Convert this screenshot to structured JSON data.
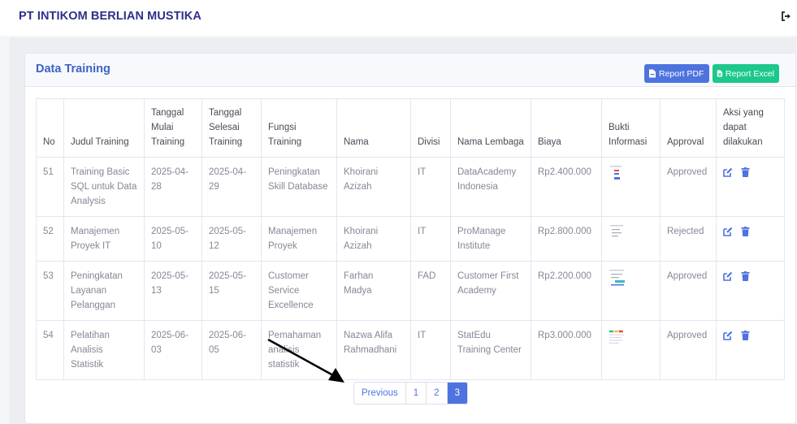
{
  "header": {
    "brand": "PT INTIKOM BERLIAN MUSTIKA"
  },
  "card": {
    "title": "Data Training",
    "report_pdf": "Report PDF",
    "report_excel": "Report Excel"
  },
  "table": {
    "columns": [
      "No",
      "Judul Training",
      "Tanggal Mulai Training",
      "Tanggal Selesai Training",
      "Fungsi Training",
      "Nama",
      "Divisi",
      "Nama Lembaga",
      "Biaya",
      "Bukti Informasi",
      "Approval",
      "Aksi yang dapat dilakukan"
    ],
    "rows": [
      {
        "no": "51",
        "judul": "Training Basic SQL untuk Data Analysis",
        "mulai": "2025-04-28",
        "selesai": "2025-04-29",
        "fungsi": "Peningkatan Skill Database",
        "nama": "Khoirani Azizah",
        "divisi": "IT",
        "lembaga": "DataAcademy Indonesia",
        "biaya": "Rp2.400.000",
        "approval": "Approved"
      },
      {
        "no": "52",
        "judul": "Manajemen Proyek IT",
        "mulai": "2025-05-10",
        "selesai": "2025-05-12",
        "fungsi": "Manajemen Proyek",
        "nama": "Khoirani Azizah",
        "divisi": "IT",
        "lembaga": "ProManage Institute",
        "biaya": "Rp2.800.000",
        "approval": "Rejected"
      },
      {
        "no": "53",
        "judul": "Peningkatan Layanan Pelanggan",
        "mulai": "2025-05-13",
        "selesai": "2025-05-15",
        "fungsi": "Customer Service Excellence",
        "nama": "Farhan Madya",
        "divisi": "FAD",
        "lembaga": "Customer First Academy",
        "biaya": "Rp2.200.000",
        "approval": "Approved"
      },
      {
        "no": "54",
        "judul": "Pelatihan Analisis Statistik",
        "mulai": "2025-06-03",
        "selesai": "2025-06-05",
        "fungsi": "Pemahaman analisis statistik",
        "nama": "Nazwa Alifa Rahmadhani",
        "divisi": "IT",
        "lembaga": "StatEdu Training Center",
        "biaya": "Rp3.000.000",
        "approval": "Approved"
      }
    ]
  },
  "pagination": {
    "previous": "Previous",
    "pages": [
      "1",
      "2",
      "3"
    ],
    "active": "3"
  },
  "icons": {
    "logout": "logout-icon",
    "pdf": "file-pdf-icon",
    "excel": "file-excel-icon",
    "edit": "edit-icon",
    "delete": "trash-icon"
  },
  "colors": {
    "primary": "#4e73df",
    "success": "#1cc88a",
    "brand": "#2e2f8a"
  }
}
